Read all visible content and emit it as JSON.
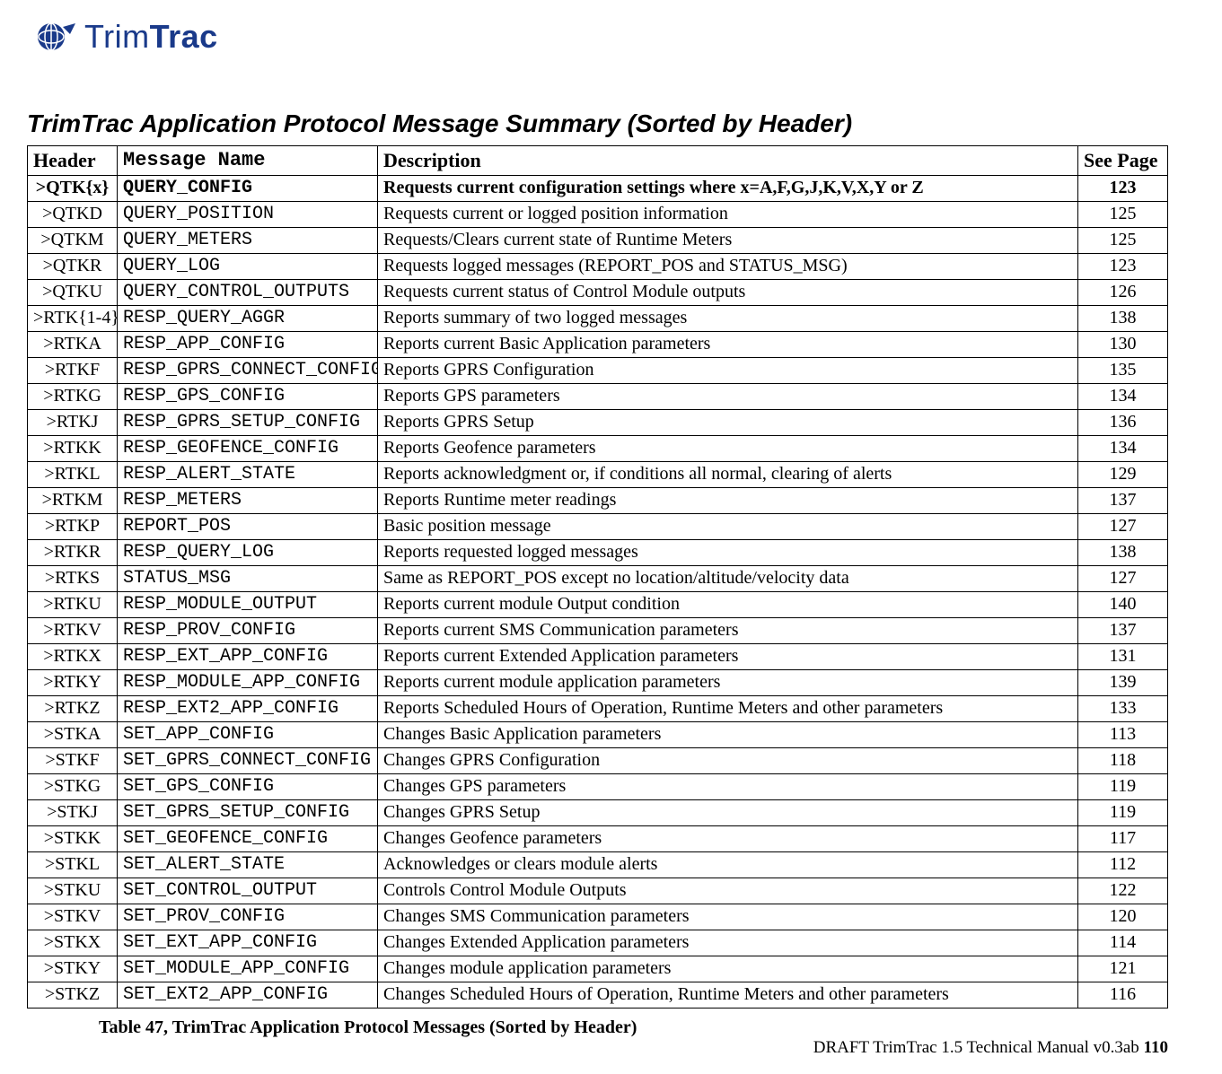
{
  "brand": {
    "name_part1": "Trim",
    "name_part2": "Trac"
  },
  "title": "TrimTrac Application Protocol Message Summary (Sorted by Header)",
  "columns": {
    "header": "Header",
    "msg": "Message Name",
    "desc": "Description",
    "page": "See Page"
  },
  "caption": "Table 47, TrimTrac Application Protocol Messages (Sorted by Header)",
  "footer": {
    "text": "DRAFT TrimTrac 1.5 Technical Manual v0.3ab ",
    "page": "110"
  },
  "rows": [
    {
      "header": ">QTK{x}",
      "msg": "QUERY_CONFIG",
      "desc": "Requests current configuration settings where x=A,F,G,J,K,V,X,Y or Z",
      "page": "123",
      "bold": true
    },
    {
      "header": ">QTKD",
      "msg": "QUERY_POSITION",
      "desc": "Requests current or logged position information",
      "page": "125"
    },
    {
      "header": ">QTKM",
      "msg": "QUERY_METERS",
      "desc": "Requests/Clears current state of Runtime Meters",
      "page": "125"
    },
    {
      "header": ">QTKR",
      "msg": "QUERY_LOG",
      "desc": "Requests logged messages (REPORT_POS and STATUS_MSG)",
      "page": "123"
    },
    {
      "header": ">QTKU",
      "msg": "QUERY_CONTROL_OUTPUTS",
      "desc": "Requests current status of Control Module outputs",
      "page": "126"
    },
    {
      "header": ">RTK{1-4}",
      "msg": "RESP_QUERY_AGGR",
      "desc": "Reports summary of two logged messages",
      "page": "138"
    },
    {
      "header": ">RTKA",
      "msg": "RESP_APP_CONFIG",
      "desc": "Reports current Basic Application parameters",
      "page": "130"
    },
    {
      "header": ">RTKF",
      "msg": "RESP_GPRS_CONNECT_CONFIG",
      "desc": "Reports GPRS Configuration",
      "page": "135"
    },
    {
      "header": ">RTKG",
      "msg": "RESP_GPS_CONFIG",
      "desc": "Reports GPS parameters",
      "page": "134"
    },
    {
      "header": ">RTKJ",
      "msg": "RESP_GPRS_SETUP_CONFIG",
      "desc": "Reports GPRS Setup",
      "page": "136"
    },
    {
      "header": ">RTKK",
      "msg": "RESP_GEOFENCE_CONFIG",
      "desc": "Reports Geofence parameters",
      "page": "134"
    },
    {
      "header": ">RTKL",
      "msg": "RESP_ALERT_STATE",
      "desc": "Reports acknowledgment or, if conditions all normal, clearing of alerts",
      "page": "129"
    },
    {
      "header": ">RTKM",
      "msg": "RESP_METERS",
      "desc": "Reports Runtime meter readings",
      "page": "137"
    },
    {
      "header": ">RTKP",
      "msg": "REPORT_POS",
      "desc": "Basic position message",
      "page": "127"
    },
    {
      "header": ">RTKR",
      "msg": "RESP_QUERY_LOG",
      "desc": "Reports requested logged messages",
      "page": "138"
    },
    {
      "header": ">RTKS",
      "msg": "STATUS_MSG",
      "desc": "Same as REPORT_POS except no location/altitude/velocity data",
      "page": "127"
    },
    {
      "header": ">RTKU",
      "msg": "RESP_MODULE_OUTPUT",
      "desc": "Reports current module Output condition",
      "page": "140"
    },
    {
      "header": ">RTKV",
      "msg": "RESP_PROV_CONFIG",
      "desc": "Reports current SMS Communication parameters",
      "page": "137"
    },
    {
      "header": ">RTKX",
      "msg": "RESP_EXT_APP_CONFIG",
      "desc": "Reports current Extended Application parameters",
      "page": "131"
    },
    {
      "header": ">RTKY",
      "msg": "RESP_MODULE_APP_CONFIG",
      "desc": "Reports current module application parameters",
      "page": "139"
    },
    {
      "header": ">RTKZ",
      "msg": "RESP_EXT2_APP_CONFIG",
      "desc": "Reports Scheduled Hours of Operation, Runtime Meters and other parameters",
      "page": "133"
    },
    {
      "header": ">STKA",
      "msg": "SET_APP_CONFIG",
      "desc": "Changes Basic Application parameters",
      "page": "113"
    },
    {
      "header": ">STKF",
      "msg": "SET_GPRS_CONNECT_CONFIG",
      "desc": "Changes GPRS Configuration",
      "page": "118"
    },
    {
      "header": ">STKG",
      "msg": "SET_GPS_CONFIG",
      "desc": "Changes GPS parameters",
      "page": "119"
    },
    {
      "header": ">STKJ",
      "msg": "SET_GPRS_SETUP_CONFIG",
      "desc": "Changes GPRS Setup",
      "page": "119"
    },
    {
      "header": ">STKK",
      "msg": "SET_GEOFENCE_CONFIG",
      "desc": "Changes Geofence parameters",
      "page": "117"
    },
    {
      "header": ">STKL",
      "msg": "SET_ALERT_STATE",
      "desc": "Acknowledges or clears module alerts",
      "page": "112"
    },
    {
      "header": ">STKU",
      "msg": "SET_CONTROL_OUTPUT",
      "desc": "Controls Control Module Outputs",
      "page": "122"
    },
    {
      "header": ">STKV",
      "msg": "SET_PROV_CONFIG",
      "desc": "Changes SMS Communication parameters",
      "page": "120"
    },
    {
      "header": ">STKX",
      "msg": "SET_EXT_APP_CONFIG",
      "desc": "Changes Extended Application parameters",
      "page": "114"
    },
    {
      "header": ">STKY",
      "msg": "SET_MODULE_APP_CONFIG",
      "desc": "Changes module application parameters",
      "page": "121"
    },
    {
      "header": ">STKZ",
      "msg": "SET_EXT2_APP_CONFIG",
      "desc": "Changes Scheduled Hours of Operation, Runtime Meters and other parameters",
      "page": "116"
    }
  ]
}
